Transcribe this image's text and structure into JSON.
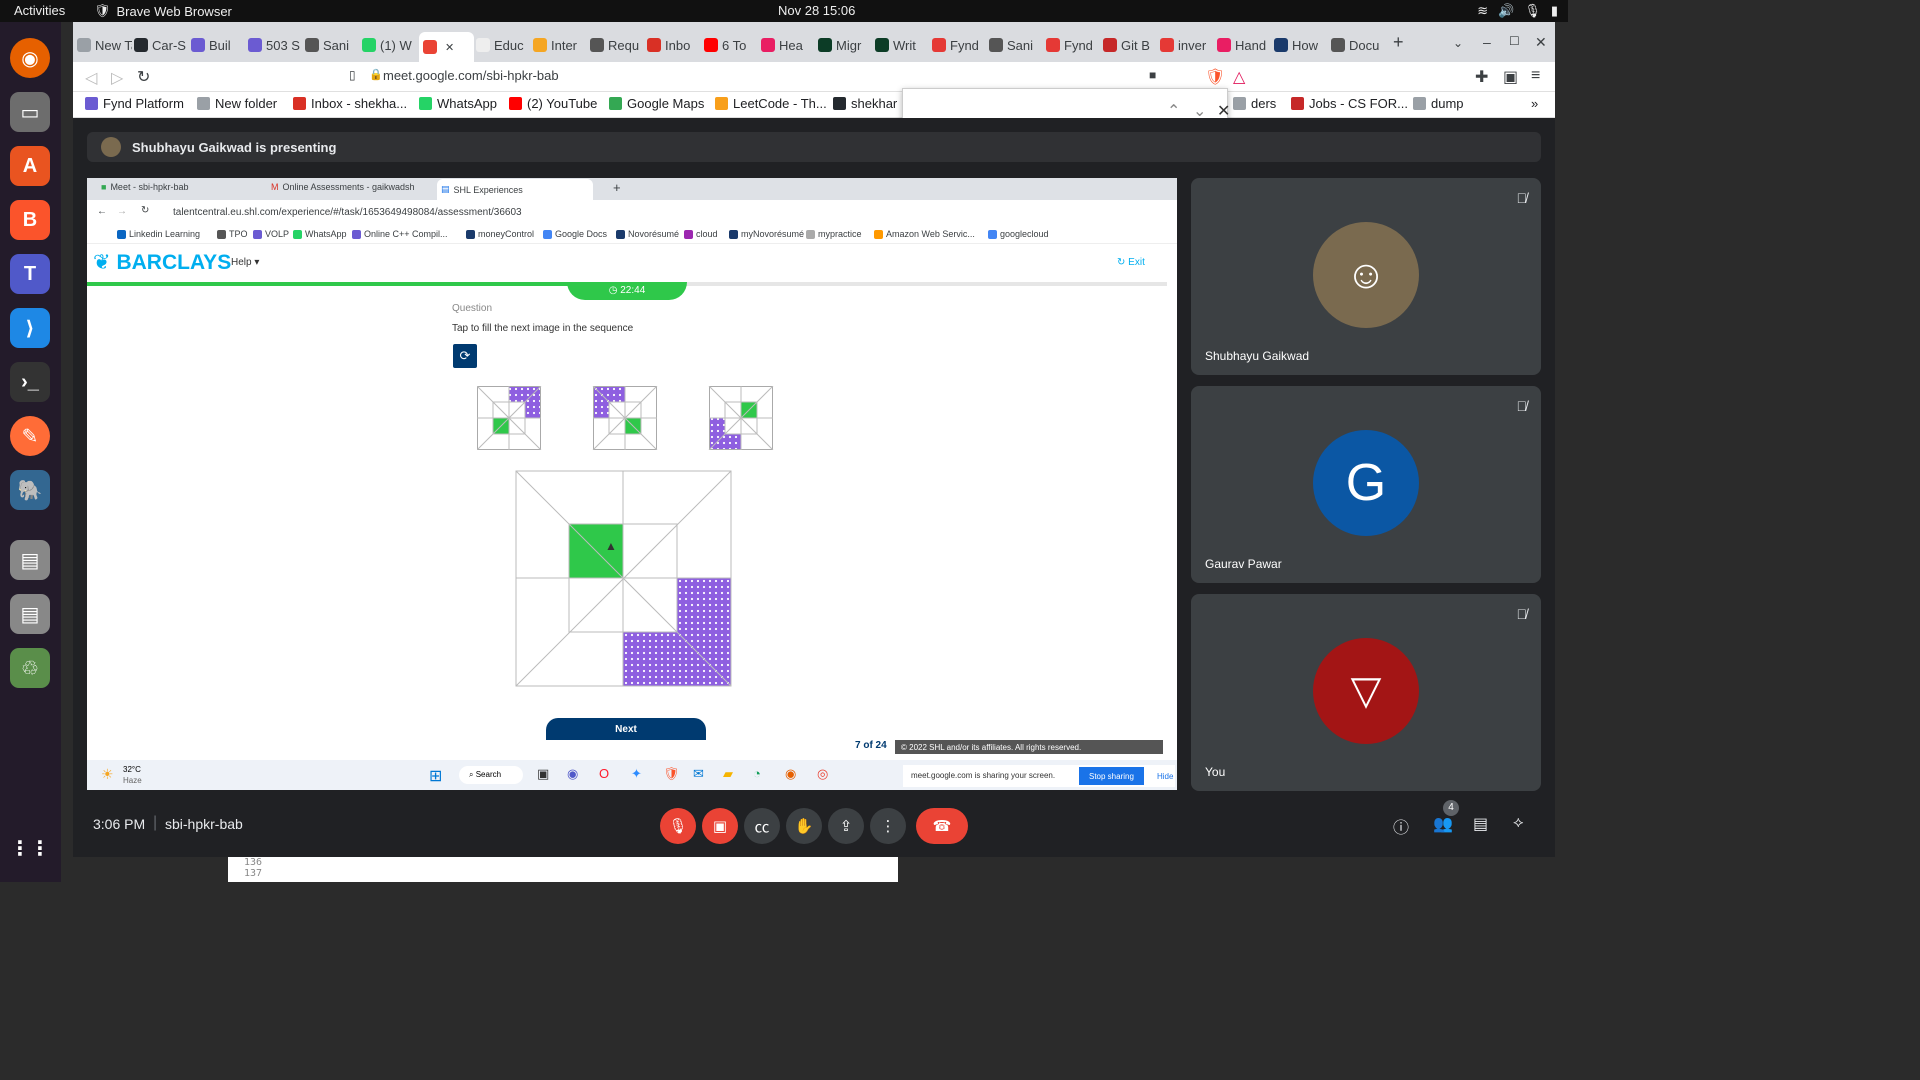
{
  "topbar": {
    "activities": "Activities",
    "app": "Brave Web Browser",
    "clock": "Nov 28  15:06"
  },
  "browser": {
    "tabs": [
      {
        "label": "New Tab",
        "color": "#9aa0a6"
      },
      {
        "label": "Car-S",
        "color": "#24292e"
      },
      {
        "label": "Buil",
        "color": "#6b5bd2"
      },
      {
        "label": "503 S",
        "color": "#6b5bd2"
      },
      {
        "label": "Sani",
        "color": "#555"
      },
      {
        "label": "(1) W",
        "color": "#25d366"
      },
      {
        "label": "",
        "color": "#ea4335"
      },
      {
        "label": "Educ",
        "color": "#eee"
      },
      {
        "label": "Inter",
        "color": "#f5a623"
      },
      {
        "label": "Requ",
        "color": "#555"
      },
      {
        "label": "Inbo",
        "color": "#d93025"
      },
      {
        "label": "6 To",
        "color": "#ff0000"
      },
      {
        "label": "Hea",
        "color": "#e91e63"
      },
      {
        "label": "Migr",
        "color": "#0c3c26"
      },
      {
        "label": "Writ",
        "color": "#0c3c26"
      },
      {
        "label": "Fynd",
        "color": "#e53935"
      },
      {
        "label": "Sani",
        "color": "#555"
      },
      {
        "label": "Fynd",
        "color": "#e53935"
      },
      {
        "label": "Git B",
        "color": "#c62828"
      },
      {
        "label": "inver",
        "color": "#e53935"
      },
      {
        "label": "Hand",
        "color": "#e91e63"
      },
      {
        "label": "How",
        "color": "#1a3a6b"
      },
      {
        "label": "Docu",
        "color": "#555"
      }
    ],
    "url": "meet.google.com/sbi-hpkr-bab",
    "bookmarks": [
      {
        "label": "Fynd Platform",
        "color": "#6b5bd2"
      },
      {
        "label": "New folder",
        "color": "#9aa0a6"
      },
      {
        "label": "Inbox - shekha...",
        "color": "#d93025"
      },
      {
        "label": "WhatsApp",
        "color": "#25d366"
      },
      {
        "label": "(2) YouTube",
        "color": "#ff0000"
      },
      {
        "label": "Google Maps",
        "color": "#34a853"
      },
      {
        "label": "LeetCode - Th...",
        "color": "#f89f1b"
      },
      {
        "label": "shekhar",
        "color": "#24292e"
      },
      {
        "label": "ders",
        "color": "#9aa0a6"
      },
      {
        "label": "Jobs - CS FOR...",
        "color": "#c62828"
      },
      {
        "label": "dump",
        "color": "#9aa0a6"
      }
    ]
  },
  "meet": {
    "presenting": "Shubhayu Gaikwad is presenting",
    "participants": [
      {
        "name": "Shubhayu Gaikwad",
        "initial": "",
        "color": "#7a6a4f"
      },
      {
        "name": "Gaurav Pawar",
        "initial": "G",
        "color": "#0b57a4"
      },
      {
        "name": "You",
        "initial": "",
        "color": "#a31515"
      }
    ],
    "time": "3:06 PM",
    "code": "sbi-hpkr-bab",
    "people_count": "4"
  },
  "shared": {
    "tabs": [
      "Meet - sbi-hpkr-bab",
      "Online Assessments - gaikwadsh",
      "SHL Experiences"
    ],
    "url": "talentcentral.eu.shl.com/experience/#/task/1653649498084/assessment/36603",
    "bookmarks": [
      "Linkedin Learning",
      "TPO",
      "VOLP",
      "WhatsApp",
      "Online C++ Compil...",
      "moneyControl",
      "Google Docs",
      "Novorésumé",
      "cloud",
      "myNovorésumé",
      "mypractice",
      "Amazon Web Servic...",
      "googlecloud"
    ],
    "brand": "BARCLAYS",
    "help": "Help",
    "exit": "Exit",
    "timer": "22:44",
    "progress": 0.46,
    "question_label": "Question",
    "question_text": "Tap to fill the next image in the sequence",
    "next": "Next",
    "page": "7 of 24",
    "copyright": "© 2022 SHL and/or its affiliates. All rights reserved.",
    "weather_temp": "32°C",
    "weather_desc": "Haze",
    "search": "Search",
    "sharing": "meet.google.com is sharing your screen.",
    "stop_sharing": "Stop sharing",
    "hide": "Hide"
  },
  "colors": {
    "green": "#2fc84a",
    "purple": "#8e5fe0",
    "barclays": "#00aeef",
    "meet_red": "#ea4335"
  }
}
